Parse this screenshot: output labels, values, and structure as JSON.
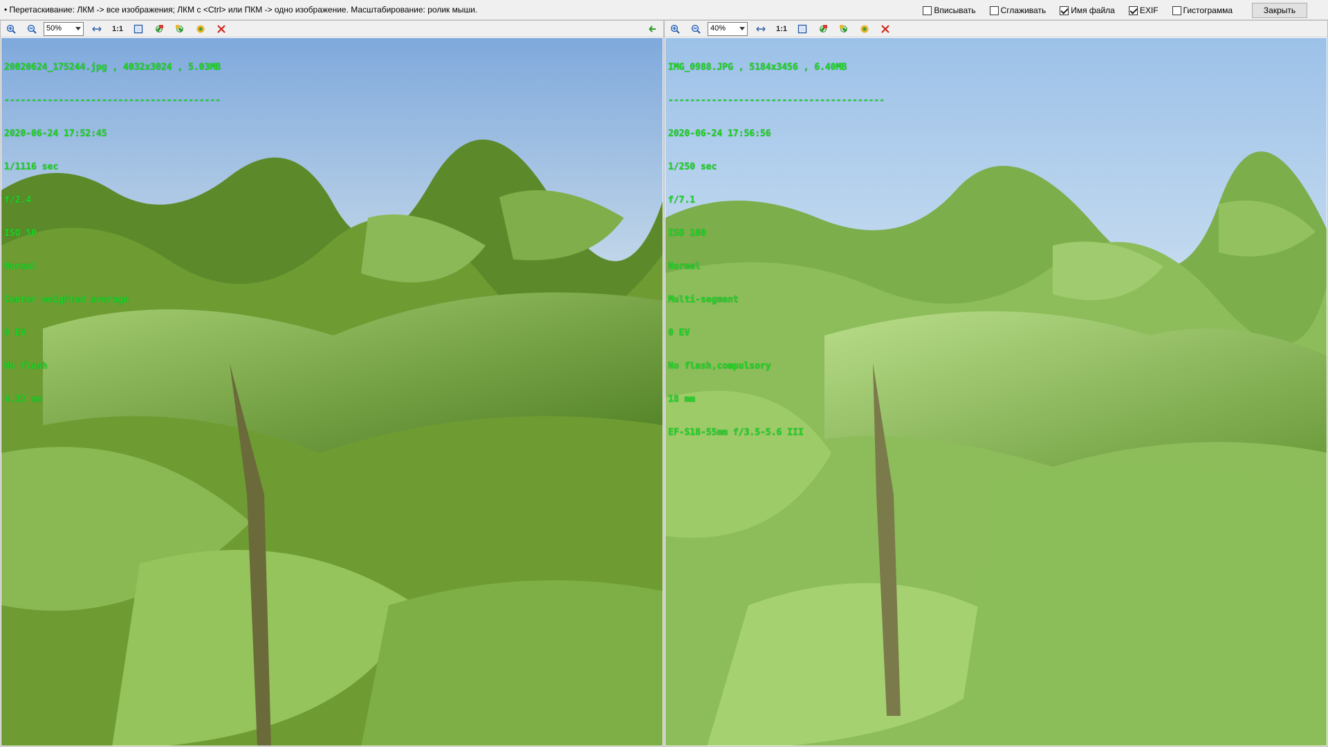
{
  "hint": "• Перетаскивание: ЛКМ -> все изображения; ЛКМ с <Ctrl> или ПКМ -> одно изображение. Масштабирование: ролик мыши.",
  "options": [
    {
      "label": "Вписывать",
      "checked": false
    },
    {
      "label": "Сглаживать",
      "checked": false
    },
    {
      "label": "Имя файла",
      "checked": true
    },
    {
      "label": "EXIF",
      "checked": true
    },
    {
      "label": "Гистограмма",
      "checked": false
    }
  ],
  "close_label": "Закрыть",
  "toolbar_labels": {
    "one_to_one": "1:1"
  },
  "left": {
    "zoom": "50%",
    "header": "20020624_175244.jpg , 4032x3024 , 5.03MB",
    "separator": "----------------------------------------",
    "exif": [
      "2020-06-24 17:52:45",
      "1/1116 sec",
      "f/2.4",
      "ISO 50",
      "Normal",
      "Center weighted average",
      "0 EV",
      "No flash",
      "4.32 mm"
    ]
  },
  "right": {
    "zoom": "40%",
    "header": "IMG_0988.JPG , 5184x3456 , 6.40MB",
    "separator": "----------------------------------------",
    "exif": [
      "2020-06-24 17:56:56",
      "1/250 sec",
      "f/7.1",
      "ISO 100",
      "Normal",
      "Multi-segment",
      "0 EV",
      "No flash,compulsory",
      "18 mm",
      "EF-S18-55mm f/3.5-5.6 III"
    ]
  },
  "colors": {
    "overlay_text": "#22d422",
    "close_icon": "#d0261c",
    "sky": "#a9c9ea",
    "leaf": "#6f9f3a"
  }
}
